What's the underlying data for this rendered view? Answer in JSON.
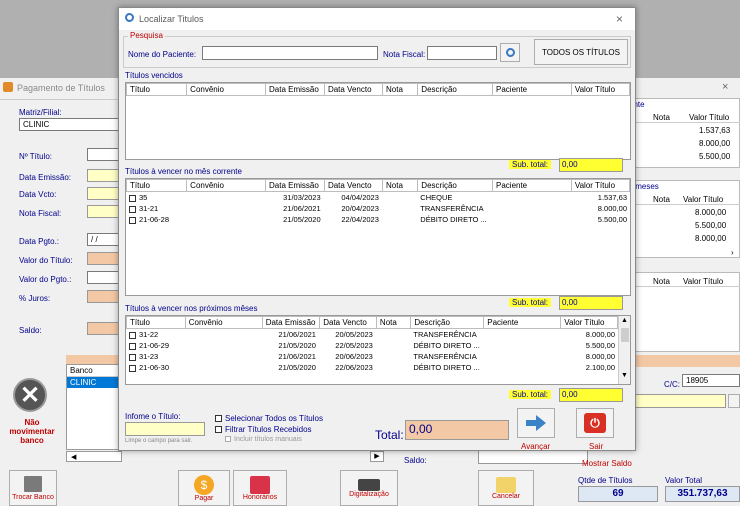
{
  "back": {
    "window_title": "Pagamento de Títulos",
    "close_icon": "×",
    "matriz_label": "Matriz/Filial:",
    "matriz_value": "CLINIC",
    "fields": [
      "Nº Título:",
      "Data Emissão:",
      "Data Vcto:",
      "Nota Fiscal:",
      "Data Pgto.:",
      "Valor do Título:",
      "Valor do Pgto.:",
      "% Juros:",
      "Saldo:"
    ],
    "data_pgto_value": "/ /",
    "banco_header": "Banco",
    "banco_row": "CLINIC",
    "nao_movimentar": "Não movimentar banco",
    "right_panel1": {
      "section": "ente",
      "headers": [
        "o",
        "Nota",
        "Valor Título"
      ],
      "values": [
        "1.537,63",
        "8.000,00",
        "5.500,00"
      ]
    },
    "right_panel2": {
      "section": "s meses",
      "headers": [
        "o",
        "Nota",
        "Valor Título"
      ],
      "values": [
        "8.000,00",
        "5.500,00",
        "8.000,00"
      ]
    },
    "right_panel3": {
      "headers": [
        "o",
        "Nota",
        "Valor Título"
      ]
    },
    "cc_label": "C/C:",
    "cc_value": "18905",
    "saldo_label": "Saldo:",
    "mostrar_saldo": "Mostrar Saldo",
    "qtde_label": "Qtde de Títulos",
    "qtde_value": "69",
    "valor_total_label": "Valor Total",
    "valor_total_value": "351.737,63",
    "bottom_buttons": [
      "Trocar Banco",
      "Pagar",
      "Honorários",
      "Digitalização",
      "Cancelar"
    ]
  },
  "dialog": {
    "title": "Localizar Titulos",
    "close_icon": "×",
    "pesquisa": "Pesquisa",
    "nome_label": "Nome do Paciente:",
    "nome_value": "",
    "nf_label": "Nota Fiscal:",
    "nf_value": "",
    "todos_button": "TODOS OS TÍTULOS",
    "headers": [
      "Título",
      "Convênio",
      "Data Emissão",
      "Data Vencto",
      "Nota",
      "Descrição",
      "Paciente",
      "Valor Título"
    ],
    "section1_label": "Títulos vencidos",
    "section2_label": "Títulos à vencer no mês corrente",
    "section3_label": "Títulos à vencer nos próximos mêses",
    "subtotal_label": "Sub. total:",
    "subtotal_values": [
      "0,00",
      "0,00",
      "0,00"
    ],
    "rows_current": [
      {
        "titulo": "35",
        "emissao": "31/03/2023",
        "vencto": "04/04/2023",
        "desc": "CHEQUE",
        "valor": "1.537,63"
      },
      {
        "titulo": "31-21",
        "emissao": "21/06/2021",
        "vencto": "20/04/2023",
        "desc": "TRANSFERÊNCIA",
        "valor": "8.000,00"
      },
      {
        "titulo": "21-06-28",
        "emissao": "21/05/2020",
        "vencto": "22/04/2023",
        "desc": "DÉBITO DIRETO ...",
        "valor": "5.500,00"
      }
    ],
    "rows_next": [
      {
        "titulo": "31-22",
        "emissao": "21/06/2021",
        "vencto": "20/05/2023",
        "desc": "TRANSFERÊNCIA",
        "valor": "8.000,00"
      },
      {
        "titulo": "21-06-29",
        "emissao": "21/05/2020",
        "vencto": "22/05/2023",
        "desc": "DÉBITO DIRETO ...",
        "valor": "5.500,00"
      },
      {
        "titulo": "31-23",
        "emissao": "21/06/2021",
        "vencto": "20/06/2023",
        "desc": "TRANSFERÊNCIA",
        "valor": "8.000,00"
      },
      {
        "titulo": "21-06-30",
        "emissao": "21/05/2020",
        "vencto": "22/06/2023",
        "desc": "DÉBITO DIRETO ...",
        "valor": "2.100,00"
      }
    ],
    "informe_label": "Infome o Título:",
    "limpe_hint": "Limpe o campo para sair.",
    "chk_todos": "Selecionar Todos os Títulos",
    "chk_filtrar": "Filtrar Títulos Recebidos",
    "chk_manuais": "Incluir títulos manuais",
    "total_label": "Total:",
    "total_value": "0,00",
    "avancar": "Avançar",
    "sair": "Sair"
  }
}
